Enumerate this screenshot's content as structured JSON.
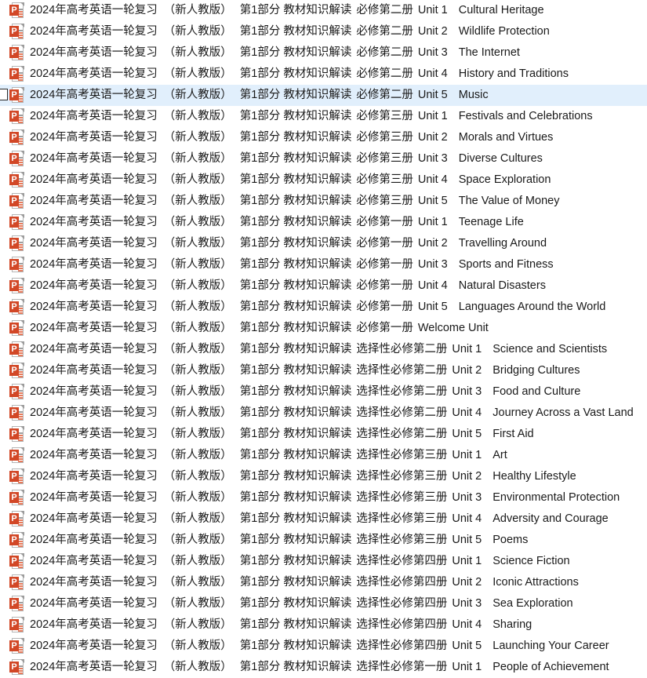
{
  "window": {
    "view": "file-list",
    "selected_row_index": 4,
    "selection_color": "#e1effc",
    "icon_color": "#d24726",
    "icon_name": "powerpoint-file-icon",
    "icon_badge_letter": "P"
  },
  "common": {
    "series": "2024年高考英语一轮复习",
    "edition": "（新人教版）",
    "part": "第1部分 教材知识解读"
  },
  "files": [
    {
      "series": "2024年高考英语一轮复习",
      "edition": "（新人教版）",
      "part": "第1部分 教材知识解读",
      "book": "必修第二册",
      "unit": "Unit 1",
      "title": "Cultural Heritage"
    },
    {
      "series": "2024年高考英语一轮复习",
      "edition": "（新人教版）",
      "part": "第1部分 教材知识解读",
      "book": "必修第二册",
      "unit": "Unit 2",
      "title": "Wildlife Protection"
    },
    {
      "series": "2024年高考英语一轮复习",
      "edition": "（新人教版）",
      "part": "第1部分 教材知识解读",
      "book": "必修第二册",
      "unit": "Unit 3",
      "title": "The Internet"
    },
    {
      "series": "2024年高考英语一轮复习",
      "edition": "（新人教版）",
      "part": "第1部分 教材知识解读",
      "book": "必修第二册",
      "unit": "Unit 4",
      "title": "History and Traditions"
    },
    {
      "series": "2024年高考英语一轮复习",
      "edition": "（新人教版）",
      "part": "第1部分 教材知识解读",
      "book": "必修第二册",
      "unit": "Unit 5",
      "title": "Music"
    },
    {
      "series": "2024年高考英语一轮复习",
      "edition": "（新人教版）",
      "part": "第1部分 教材知识解读",
      "book": "必修第三册",
      "unit": "Unit 1",
      "title": "Festivals and Celebrations"
    },
    {
      "series": "2024年高考英语一轮复习",
      "edition": "（新人教版）",
      "part": "第1部分 教材知识解读",
      "book": "必修第三册",
      "unit": "Unit 2",
      "title": "Morals and Virtues"
    },
    {
      "series": "2024年高考英语一轮复习",
      "edition": "（新人教版）",
      "part": "第1部分 教材知识解读",
      "book": "必修第三册",
      "unit": "Unit 3",
      "title": "Diverse Cultures"
    },
    {
      "series": "2024年高考英语一轮复习",
      "edition": "（新人教版）",
      "part": "第1部分 教材知识解读",
      "book": "必修第三册",
      "unit": "Unit 4",
      "title": "Space Exploration"
    },
    {
      "series": "2024年高考英语一轮复习",
      "edition": "（新人教版）",
      "part": "第1部分 教材知识解读",
      "book": "必修第三册",
      "unit": "Unit 5",
      "title": "The Value of Money"
    },
    {
      "series": "2024年高考英语一轮复习",
      "edition": "（新人教版）",
      "part": "第1部分 教材知识解读",
      "book": "必修第一册",
      "unit": "Unit 1",
      "title": "Teenage Life"
    },
    {
      "series": "2024年高考英语一轮复习",
      "edition": "（新人教版）",
      "part": "第1部分 教材知识解读",
      "book": "必修第一册",
      "unit": "Unit 2",
      "title": "Travelling Around"
    },
    {
      "series": "2024年高考英语一轮复习",
      "edition": "（新人教版）",
      "part": "第1部分 教材知识解读",
      "book": "必修第一册",
      "unit": "Unit 3",
      "title": "Sports and Fitness"
    },
    {
      "series": "2024年高考英语一轮复习",
      "edition": "（新人教版）",
      "part": "第1部分 教材知识解读",
      "book": "必修第一册",
      "unit": "Unit 4",
      "title": "Natural Disasters"
    },
    {
      "series": "2024年高考英语一轮复习",
      "edition": "（新人教版）",
      "part": "第1部分 教材知识解读",
      "book": "必修第一册",
      "unit": "Unit 5",
      "title": "Languages Around the World"
    },
    {
      "series": "2024年高考英语一轮复习",
      "edition": "（新人教版）",
      "part": "第1部分 教材知识解读",
      "book": "必修第一册",
      "unit": "Welcome Unit",
      "title": ""
    },
    {
      "series": "2024年高考英语一轮复习",
      "edition": "（新人教版）",
      "part": "第1部分 教材知识解读",
      "book": "选择性必修第二册",
      "unit": "Unit 1",
      "title": "Science and Scientists"
    },
    {
      "series": "2024年高考英语一轮复习",
      "edition": "（新人教版）",
      "part": "第1部分 教材知识解读",
      "book": "选择性必修第二册",
      "unit": "Unit 2",
      "title": "Bridging Cultures"
    },
    {
      "series": "2024年高考英语一轮复习",
      "edition": "（新人教版）",
      "part": "第1部分 教材知识解读",
      "book": "选择性必修第二册",
      "unit": "Unit 3",
      "title": "Food and Culture"
    },
    {
      "series": "2024年高考英语一轮复习",
      "edition": "（新人教版）",
      "part": "第1部分 教材知识解读",
      "book": "选择性必修第二册",
      "unit": "Unit 4",
      "title": "Journey Across a Vast Land"
    },
    {
      "series": "2024年高考英语一轮复习",
      "edition": "（新人教版）",
      "part": "第1部分 教材知识解读",
      "book": "选择性必修第二册",
      "unit": "Unit 5",
      "title": "First Aid"
    },
    {
      "series": "2024年高考英语一轮复习",
      "edition": "（新人教版）",
      "part": "第1部分 教材知识解读",
      "book": "选择性必修第三册",
      "unit": "Unit 1",
      "title": "Art"
    },
    {
      "series": "2024年高考英语一轮复习",
      "edition": "（新人教版）",
      "part": "第1部分 教材知识解读",
      "book": "选择性必修第三册",
      "unit": "Unit 2",
      "title": "Healthy Lifestyle"
    },
    {
      "series": "2024年高考英语一轮复习",
      "edition": "（新人教版）",
      "part": "第1部分 教材知识解读",
      "book": "选择性必修第三册",
      "unit": "Unit 3",
      "title": "Environmental Protection"
    },
    {
      "series": "2024年高考英语一轮复习",
      "edition": "（新人教版）",
      "part": "第1部分 教材知识解读",
      "book": "选择性必修第三册",
      "unit": "Unit 4",
      "title": "Adversity and Courage"
    },
    {
      "series": "2024年高考英语一轮复习",
      "edition": "（新人教版）",
      "part": "第1部分 教材知识解读",
      "book": "选择性必修第三册",
      "unit": "Unit 5",
      "title": "Poems"
    },
    {
      "series": "2024年高考英语一轮复习",
      "edition": "（新人教版）",
      "part": "第1部分 教材知识解读",
      "book": "选择性必修第四册",
      "unit": "Unit 1",
      "title": "Science Fiction"
    },
    {
      "series": "2024年高考英语一轮复习",
      "edition": "（新人教版）",
      "part": "第1部分 教材知识解读",
      "book": "选择性必修第四册",
      "unit": "Unit 2",
      "title": "Iconic Attractions"
    },
    {
      "series": "2024年高考英语一轮复习",
      "edition": "（新人教版）",
      "part": "第1部分 教材知识解读",
      "book": "选择性必修第四册",
      "unit": "Unit 3",
      "title": "Sea Exploration"
    },
    {
      "series": "2024年高考英语一轮复习",
      "edition": "（新人教版）",
      "part": "第1部分 教材知识解读",
      "book": "选择性必修第四册",
      "unit": "Unit 4",
      "title": "Sharing"
    },
    {
      "series": "2024年高考英语一轮复习",
      "edition": "（新人教版）",
      "part": "第1部分 教材知识解读",
      "book": "选择性必修第四册",
      "unit": "Unit 5",
      "title": "Launching Your Career"
    },
    {
      "series": "2024年高考英语一轮复习",
      "edition": "（新人教版）",
      "part": "第1部分 教材知识解读",
      "book": "选择性必修第一册",
      "unit": "Unit 1",
      "title": "People of Achievement"
    }
  ]
}
